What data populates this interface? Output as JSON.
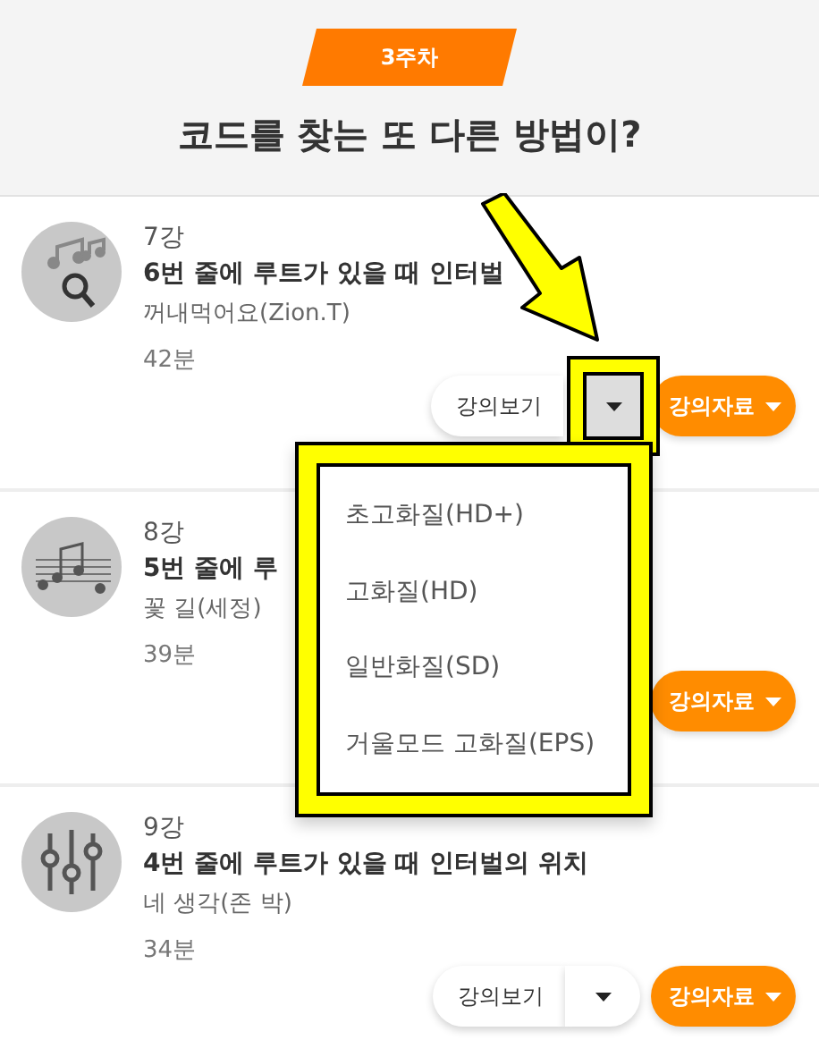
{
  "header": {
    "week_badge": "3주차",
    "title": "코드를 찾는 또 다른 방법이?"
  },
  "lessons": [
    {
      "number": "7강",
      "title": "6번 줄에 루트가 있을 때 인터벌",
      "artist": "꺼내먹어요(Zion.T)",
      "duration": "42분",
      "view_label": "강의보기",
      "materials_label": "강의자료",
      "menu_open": true
    },
    {
      "number": "8강",
      "title": "5번 줄에 루",
      "artist": "꽃 길(세정)",
      "duration": "39분",
      "materials_label": "강의자료"
    },
    {
      "number": "9강",
      "title": "4번 줄에 루트가 있을 때 인터벌의 위치",
      "artist": "네 생각(존 박)",
      "duration": "34분",
      "view_label": "강의보기",
      "materials_label": "강의자료"
    }
  ],
  "quality_menu": [
    "초고화질(HD+)",
    "고화질(HD)",
    "일반화질(SD)",
    "거울모드 고화질(EPS)"
  ]
}
